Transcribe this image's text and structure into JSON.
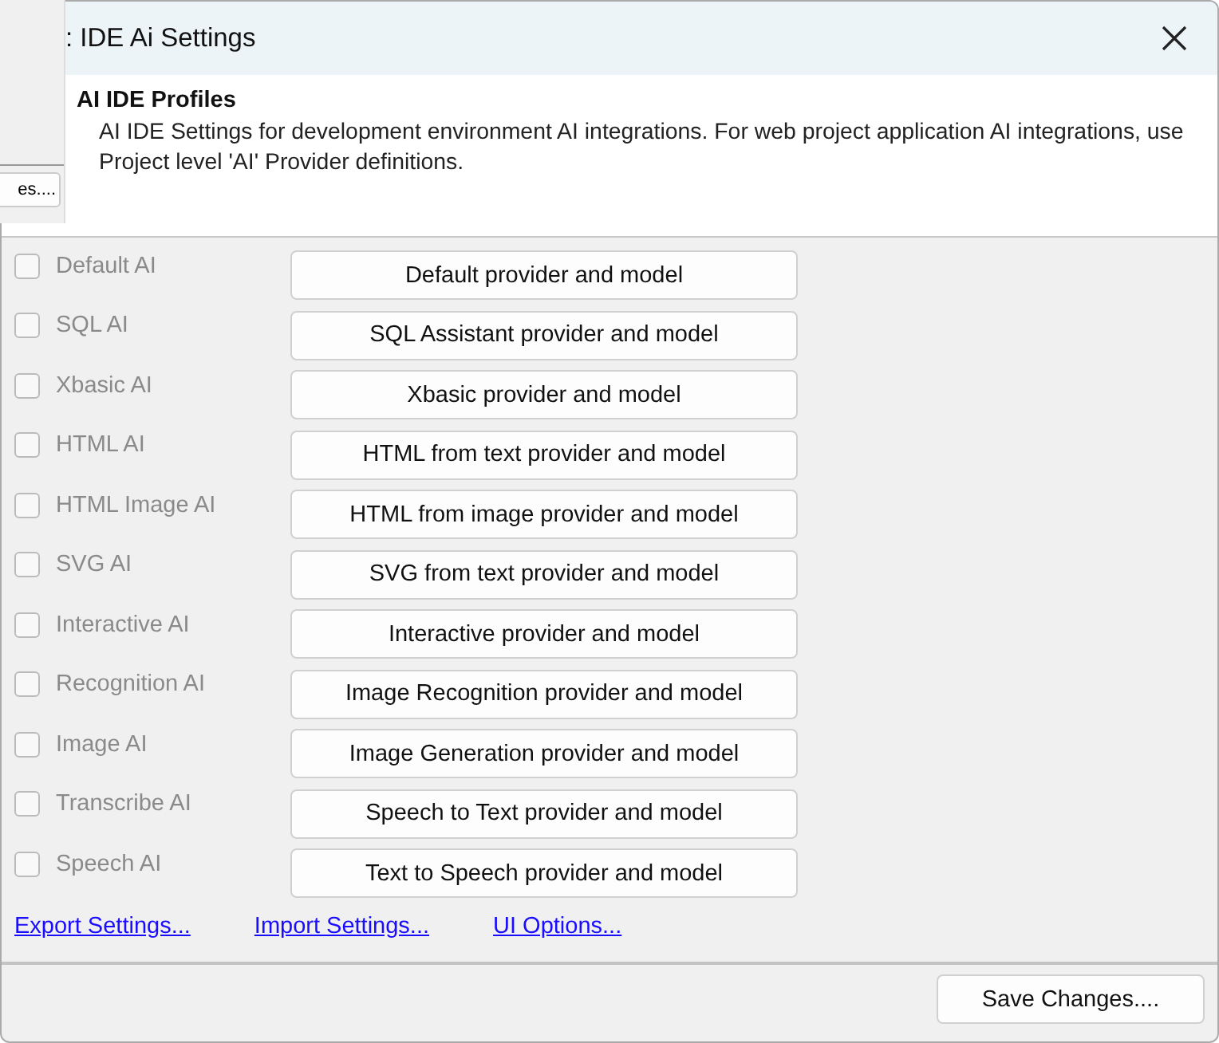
{
  "background_window": {
    "button": "es...."
  },
  "window": {
    "title": ": IDE Ai Settings"
  },
  "header": {
    "title": "AI IDE Profiles",
    "description": "AI IDE Settings for development environment AI integrations.  For web project application AI integrations, use Project level 'AI' Provider definitions."
  },
  "profiles": [
    {
      "label": "Default AI",
      "checked": false,
      "disabled": true,
      "button": "Default provider and model"
    },
    {
      "label": "SQL AI",
      "checked": false,
      "disabled": true,
      "button": "SQL Assistant provider and model"
    },
    {
      "label": "Xbasic AI",
      "checked": false,
      "disabled": true,
      "button": "Xbasic provider and model"
    },
    {
      "label": "HTML AI",
      "checked": false,
      "disabled": true,
      "button": "HTML from text provider and model"
    },
    {
      "label": "HTML Image AI",
      "checked": false,
      "disabled": true,
      "button": "HTML from image provider and model"
    },
    {
      "label": "SVG AI",
      "checked": false,
      "disabled": true,
      "button": "SVG from text provider and model"
    },
    {
      "label": "Interactive AI",
      "checked": false,
      "disabled": true,
      "button": "Interactive provider and model"
    },
    {
      "label": "Recognition AI",
      "checked": false,
      "disabled": true,
      "button": "Image Recognition provider and model"
    },
    {
      "label": "Image AI",
      "checked": false,
      "disabled": true,
      "button": "Image Generation provider and model"
    },
    {
      "label": "Transcribe AI",
      "checked": false,
      "disabled": true,
      "button": "Speech to Text provider and model"
    },
    {
      "label": "Speech AI",
      "checked": false,
      "disabled": true,
      "button": "Text to Speech provider and model"
    }
  ],
  "links": [
    "Export Settings...",
    "Import Settings...",
    "UI Options..."
  ],
  "footer": {
    "button": "Save Changes...."
  }
}
